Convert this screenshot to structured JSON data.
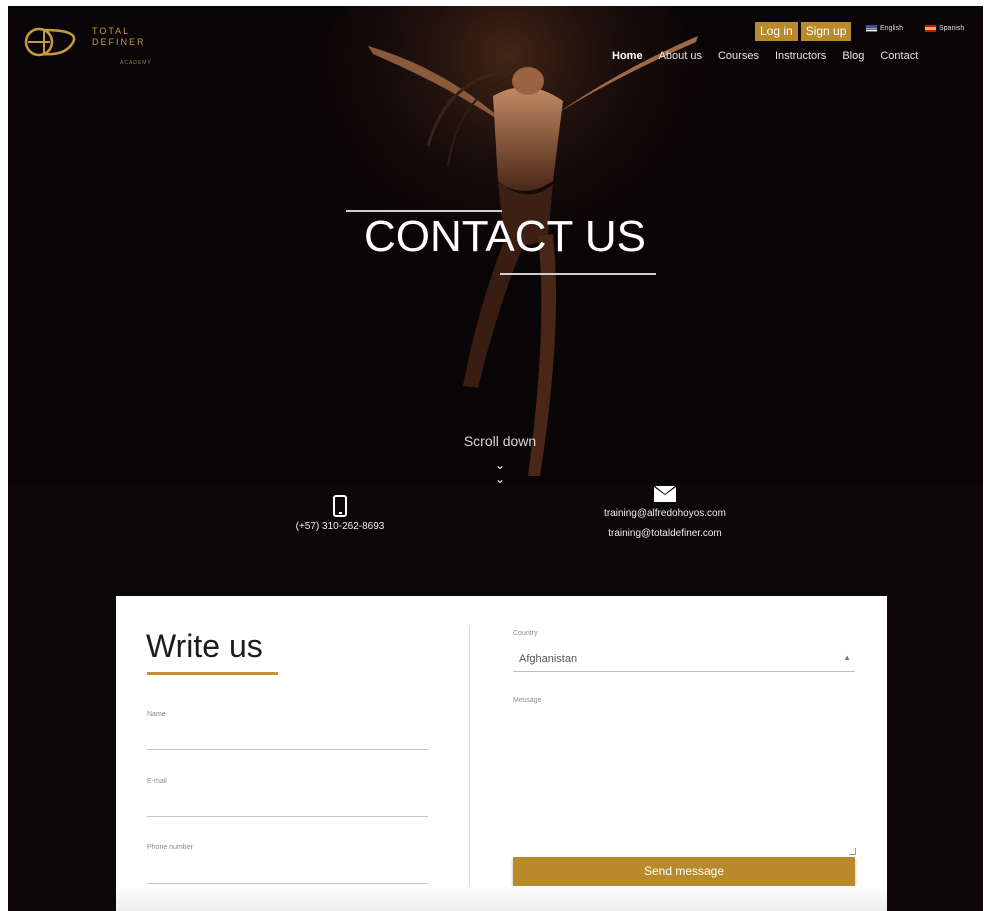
{
  "brand": {
    "logo_line1": "TOTAL",
    "logo_line2": "DEFINER",
    "logo_sub": "ACADEMY",
    "accent": "#b98a2c"
  },
  "header": {
    "login": "Log in",
    "signup": "Sign up",
    "languages": [
      {
        "label": "English",
        "flag": "us-flag-icon"
      },
      {
        "label": "Spanish",
        "flag": "es-flag-icon"
      }
    ],
    "nav": [
      "Home",
      "About us",
      "Courses",
      "Instructors",
      "Blog",
      "Contact"
    ],
    "active_nav": "Home"
  },
  "hero": {
    "title": "CONTACT US",
    "scroll_label": "Scroll down",
    "scroll_icon": "double-chevron-down-icon"
  },
  "contact": {
    "phone_icon": "phone-icon",
    "phone": "(+57) 310-262-8693",
    "mail_icon": "envelope-icon",
    "emails": [
      "training@alfredohoyos.com",
      "training@totaldefiner.com"
    ]
  },
  "form": {
    "title": "Write us",
    "fields": [
      {
        "label": "Name",
        "value": ""
      },
      {
        "label": "E-mail",
        "value": ""
      },
      {
        "label": "Phone number",
        "value": ""
      }
    ],
    "country_label": "Country",
    "country_value": "Afghanistan",
    "message_label": "Message",
    "send_label": "Send message"
  }
}
